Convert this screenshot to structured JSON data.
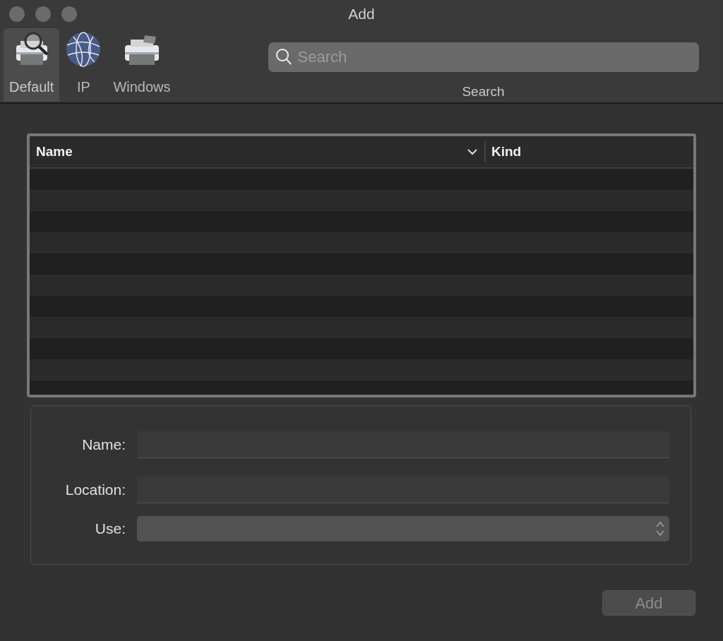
{
  "window": {
    "title": "Add"
  },
  "toolbar": {
    "tabs": [
      {
        "label": "Default",
        "selected": true,
        "kind": "default"
      },
      {
        "label": "IP",
        "selected": false,
        "kind": "ip"
      },
      {
        "label": "Windows",
        "selected": false,
        "kind": "windows"
      }
    ],
    "search": {
      "placeholder": "Search",
      "label": "Search"
    }
  },
  "table": {
    "columns": [
      "Name",
      "Kind"
    ]
  },
  "form": {
    "fields": [
      {
        "label": "Name:",
        "kind": "text"
      },
      {
        "label": "Location:",
        "kind": "text"
      },
      {
        "label": "Use:",
        "kind": "select"
      }
    ]
  },
  "buttons": [
    {
      "label": "Add",
      "disabled": true
    }
  ]
}
